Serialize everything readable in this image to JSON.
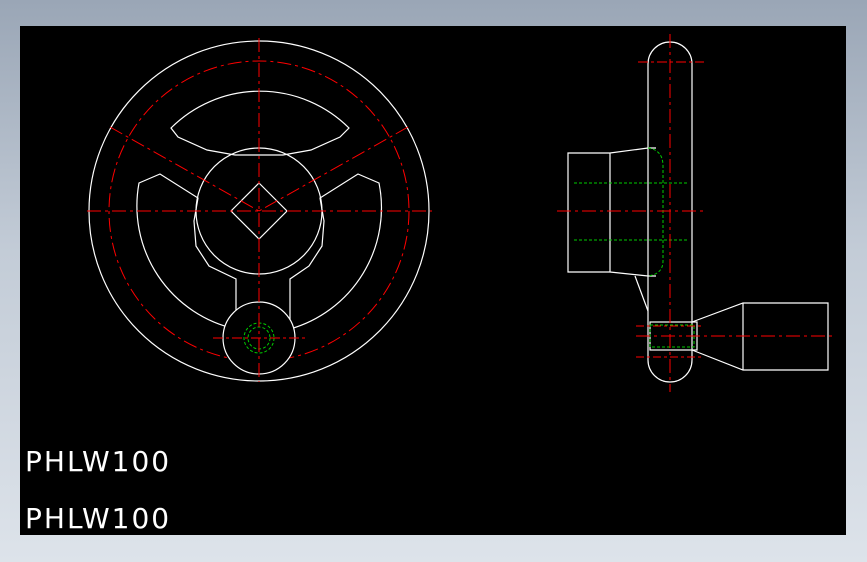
{
  "drawing": {
    "labels": [
      "PHLW100",
      "PHLW100"
    ],
    "colors": {
      "background": "#000000",
      "outline": "#ffffff",
      "centerline": "#ff0000",
      "hidden": "#00cc00",
      "frame": "#b7c0cc"
    }
  }
}
